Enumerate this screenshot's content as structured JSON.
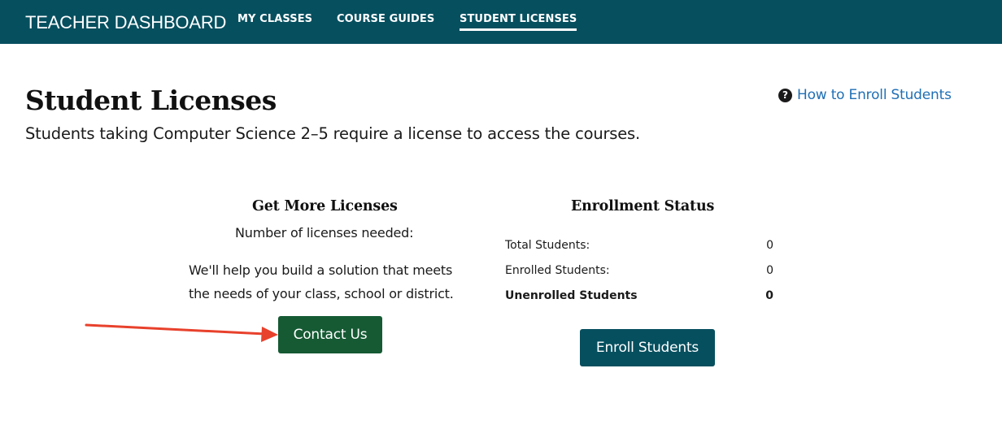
{
  "header": {
    "brand": "TEACHER DASHBOARD",
    "nav": [
      {
        "label": "MY CLASSES"
      },
      {
        "label": "COURSE GUIDES"
      },
      {
        "label": "STUDENT LICENSES",
        "active": true
      }
    ],
    "background_color": "#064f5f"
  },
  "page": {
    "title": "Student Licenses",
    "subtitle": "Students taking Computer Science 2–5 require a license to access the courses.",
    "help_link": {
      "icon": "question-circle-icon",
      "label": "How to Enroll Students"
    }
  },
  "licenses": {
    "heading": "Get More Licenses",
    "needed_label": "Number of licenses needed:",
    "help_text": "We'll help you build a solution that meets the needs of your class, school or district.",
    "contact_button": "Contact Us",
    "contact_button_color": "#155a33"
  },
  "enrollment": {
    "heading": "Enrollment Status",
    "rows": [
      {
        "label": "Total Students:",
        "value": "0"
      },
      {
        "label": "Enrolled Students:",
        "value": "0"
      },
      {
        "label": "Unenrolled Students",
        "value": "0",
        "bold": true
      }
    ],
    "enroll_button": "Enroll Students",
    "enroll_button_color": "#064f5f"
  },
  "annotation": {
    "icon": "red-arrow-icon",
    "color": "#e8412c"
  }
}
